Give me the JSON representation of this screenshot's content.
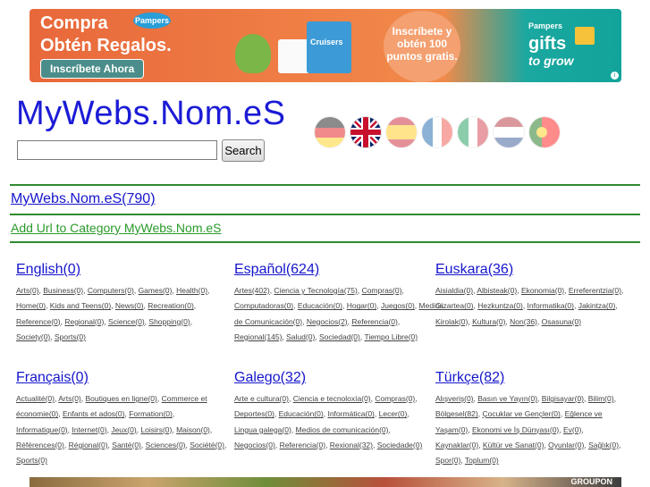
{
  "banner": {
    "line1": "Compra",
    "brand": "Pampers",
    "line2": "Obtén Regalos.",
    "cta": "Inscríbete Ahora",
    "product": "Cruisers",
    "circle_text": "Inscríbete y obtén 100 puntos gratis.",
    "gifts_brand": "Pampers",
    "gifts_line1": "gifts",
    "gifts_line2": "to grow",
    "info": "i"
  },
  "site": {
    "title": "MyWebs.Nom.eS",
    "search_placeholder": "",
    "search_button": "Search"
  },
  "flags": [
    {
      "name": "flag-germany-icon",
      "active": false
    },
    {
      "name": "flag-uk-icon",
      "active": true
    },
    {
      "name": "flag-spain-icon",
      "active": false
    },
    {
      "name": "flag-france-icon",
      "active": false
    },
    {
      "name": "flag-italy-icon",
      "active": false
    },
    {
      "name": "flag-netherlands-icon",
      "active": false
    },
    {
      "name": "flag-portugal-icon",
      "active": false
    }
  ],
  "nav": {
    "root_link": "MyWebs.Nom.eS(790)",
    "add_link": "Add Url to Category MyWebs.Nom.eS"
  },
  "categories": [
    {
      "title": "English(0)",
      "subs": [
        "Arts(0)",
        "Business(0)",
        "Computers(0)",
        "Games(0)",
        "Health(0)",
        "Home(0)",
        "Kids and Teens(0)",
        "News(0)",
        "Recreation(0)",
        "Reference(0)",
        "Regional(0)",
        "Science(0)",
        "Shopping(0)",
        "Society(0)",
        "Sports(0)"
      ]
    },
    {
      "title": "Español(624)",
      "subs": [
        "Artes(402)",
        "Ciencia y Tecnología(75)",
        "Compras(0)",
        "Computadoras(0)",
        "Educación(0)",
        "Hogar(0)",
        "Juegos(0)",
        "Medios de Comunicación(0)",
        "Negocios(2)",
        "Referencia(0)",
        "Regional(145)",
        "Salud(0)",
        "Sociedad(0)",
        "Tiempo Libre(0)"
      ]
    },
    {
      "title": "Euskara(36)",
      "subs": [
        "Aisialdia(0)",
        "Albisteak(0)",
        "Ekonomia(0)",
        "Erreferentzia(0)",
        "Gizartea(0)",
        "Hezkuntza(0)",
        "Informatika(0)",
        "Jakintza(0)",
        "Kirolak(0)",
        "Kultura(0)",
        "Non(36)",
        "Osasuna(0)"
      ]
    },
    {
      "title": "Français(0)",
      "subs": [
        "Actualité(0)",
        "Arts(0)",
        "Boutiques en ligne(0)",
        "Commerce et économie(0)",
        "Enfants et ados(0)",
        "Formation(0)",
        "Informatique(0)",
        "Internet(0)",
        "Jeux(0)",
        "Loisirs(0)",
        "Maison(0)",
        "Références(0)",
        "Régional(0)",
        "Santé(0)",
        "Sciences(0)",
        "Société(0)",
        "Sports(0)"
      ]
    },
    {
      "title": "Galego(32)",
      "subs": [
        "Arte e cultura(0)",
        "Ciencia e tecnoloxía(0)",
        "Compras(0)",
        "Deportes(0)",
        "Educación(0)",
        "Informática(0)",
        "Lecer(0)",
        "Lingua galega(0)",
        "Medios de comunicación(0)",
        "Negocios(0)",
        "Referencia(0)",
        "Rexional(32)",
        "Sociedade(0)"
      ]
    },
    {
      "title": "Türkçe(82)",
      "subs": [
        "Alışveriş(0)",
        "Basın ve Yayın(0)",
        "Bilgisayar(0)",
        "Bilim(0)",
        "Bölgesel(82)",
        "Çocuklar ve Gençler(0)",
        "Eğlence ve Yaşam(0)",
        "Ekonomi ve İş Dünyası(0)",
        "Ev(0)",
        "Kaynaklar(0)",
        "Kültür ve Sanat(0)",
        "Oyunlar(0)",
        "Sağlık(0)",
        "Spor(0)",
        "Toplum(0)"
      ]
    }
  ],
  "bottom_ad": {
    "label": "GROUPON"
  }
}
